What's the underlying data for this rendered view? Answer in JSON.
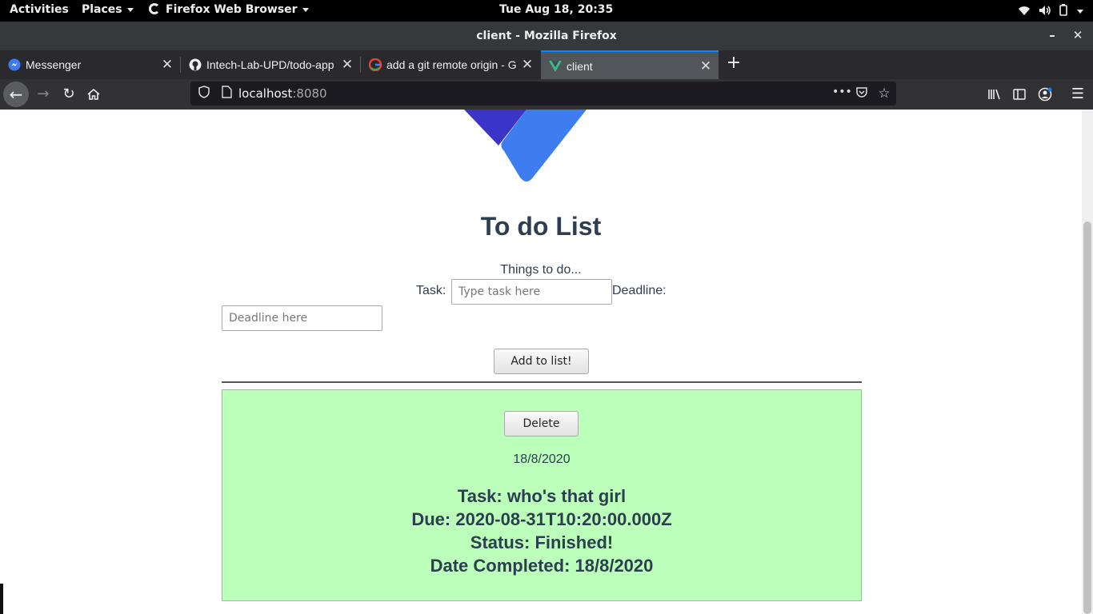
{
  "topbar": {
    "activities": "Activities",
    "places": "Places",
    "app_name": "Firefox Web Browser",
    "clock": "Tue Aug 18, 20:35"
  },
  "window": {
    "title": "client - Mozilla Firefox"
  },
  "tabs": [
    {
      "label": "Messenger",
      "icon": "messenger-icon"
    },
    {
      "label": "Intech-Lab-UPD/todo-app",
      "icon": "github-icon"
    },
    {
      "label": "add a git remote origin - G",
      "icon": "google-icon"
    },
    {
      "label": "client",
      "icon": "vue-icon",
      "selected": true
    }
  ],
  "urlbar": {
    "host": "localhost",
    "port": ":8080"
  },
  "page": {
    "heading": "To do List",
    "subheading": "Things to do...",
    "task_label": "Task:",
    "task_placeholder": "Type task here",
    "deadline_label": "Deadline:",
    "deadline_placeholder": "Deadline here",
    "add_button": "Add to list!"
  },
  "todo_item": {
    "delete_button": "Delete",
    "created_date": "18/8/2020",
    "task": "Task: who's that girl",
    "due": "Due: 2020-08-31T10:20:00.000Z",
    "status": "Status: Finished!",
    "completed": "Date Completed: 18/8/2020",
    "background": "#bbffbb"
  },
  "colors": {
    "accent": "#0a84ff",
    "text": "#2c3e50"
  }
}
